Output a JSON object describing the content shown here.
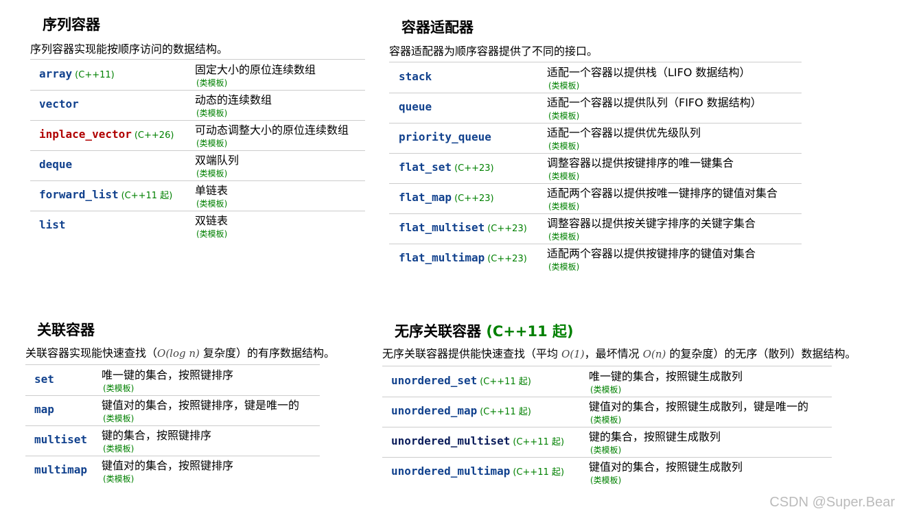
{
  "sequence": {
    "title": "序列容器",
    "desc": "序列容器实现能按顺序访问的数据结构。",
    "rows": [
      {
        "name": "array",
        "ver": "(C++11)",
        "desc": "固定大小的原位连续数组",
        "tag": "(类模板)"
      },
      {
        "name": "vector",
        "ver": "",
        "desc": "动态的连续数组",
        "tag": "(类模板)"
      },
      {
        "name": "inplace_vector",
        "ver": "(C++26)",
        "desc": "可动态调整大小的原位连续数组",
        "tag": "(类模板)"
      },
      {
        "name": "deque",
        "ver": "",
        "desc": "双端队列",
        "tag": "(类模板)"
      },
      {
        "name": "forward_list",
        "ver": "(C++11 起)",
        "desc": "单链表",
        "tag": "(类模板)"
      },
      {
        "name": "list",
        "ver": "",
        "desc": "双链表",
        "tag": "(类模板)"
      }
    ]
  },
  "adaptors": {
    "title": "容器适配器",
    "desc": "容器适配器为顺序容器提供了不同的接口。",
    "rows": [
      {
        "name": "stack",
        "ver": "",
        "desc": "适配一个容器以提供栈（LIFO 数据结构）",
        "tag": "(类模板)"
      },
      {
        "name": "queue",
        "ver": "",
        "desc": "适配一个容器以提供队列（FIFO 数据结构）",
        "tag": "(类模板)"
      },
      {
        "name": "priority_queue",
        "ver": "",
        "desc": "适配一个容器以提供优先级队列",
        "tag": "(类模板)"
      },
      {
        "name": "flat_set",
        "ver": "(C++23)",
        "desc": "调整容器以提供按键排序的唯一键集合",
        "tag": "(类模板)"
      },
      {
        "name": "flat_map",
        "ver": "(C++23)",
        "desc": "适配两个容器以提供按唯一键排序的键值对集合",
        "tag": "(类模板)"
      },
      {
        "name": "flat_multiset",
        "ver": "(C++23)",
        "desc": "调整容器以提供按关键字排序的关键字集合",
        "tag": "(类模板)"
      },
      {
        "name": "flat_multimap",
        "ver": "(C++23)",
        "desc": "适配两个容器以提供按键排序的键值对集合",
        "tag": "(类模板)"
      }
    ]
  },
  "associative": {
    "title": "关联容器",
    "desc_pre": "关联容器实现能快速查找（",
    "desc_math": "O(log n)",
    "desc_post": " 复杂度）的有序数据结构。",
    "rows": [
      {
        "name": "set",
        "ver": "",
        "desc": "唯一键的集合，按照键排序",
        "tag": "(类模板)"
      },
      {
        "name": "map",
        "ver": "",
        "desc": "键值对的集合，按照键排序，键是唯一的",
        "tag": "(类模板)"
      },
      {
        "name": "multiset",
        "ver": "",
        "desc": "键的集合，按照键排序",
        "tag": "(类模板)"
      },
      {
        "name": "multimap",
        "ver": "",
        "desc": "键值对的集合，按照键排序",
        "tag": "(类模板)"
      }
    ]
  },
  "unordered": {
    "title": "无序关联容器",
    "since": "(C++11 起)",
    "desc_pre": "无序关联容器提供能快速查找（平均 ",
    "desc_math1": "O(1)",
    "desc_mid": "，最坏情况 ",
    "desc_math2": "O(n)",
    "desc_post": " 的复杂度）的无序（散列）数据结构。",
    "rows": [
      {
        "name": "unordered_set",
        "ver": "(C++11 起)",
        "desc": "唯一键的集合，按照键生成散列",
        "tag": "(类模板)"
      },
      {
        "name": "unordered_map",
        "ver": "(C++11 起)",
        "desc": "键值对的集合，按照键生成散列，键是唯一的",
        "tag": "(类模板)"
      },
      {
        "name": "unordered_multiset",
        "ver": "(C++11 起)",
        "desc": "键的集合，按照键生成散列",
        "tag": "(类模板)"
      },
      {
        "name": "unordered_multimap",
        "ver": "(C++11 起)",
        "desc": "键值对的集合，按照键生成散列",
        "tag": "(类模板)"
      }
    ]
  },
  "watermark": "CSDN @Super.Bear"
}
